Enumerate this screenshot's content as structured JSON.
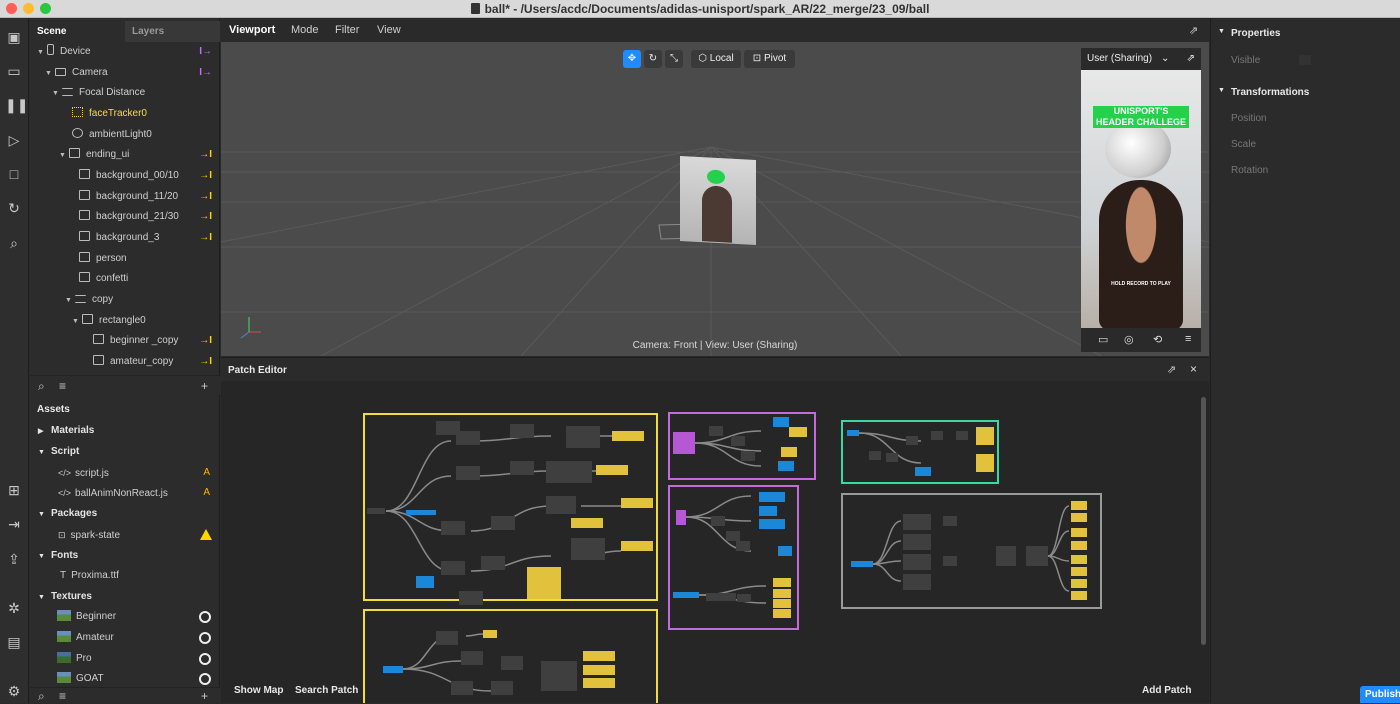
{
  "window": {
    "title": "ball* - /Users/acdc/Documents/adidas-unisport/spark_AR/22_merge/23_09/ball"
  },
  "scene_tabs": {
    "scene": "Scene",
    "layers": "Layers"
  },
  "scene_tree": [
    {
      "label": "Device",
      "badge": "I→",
      "badge_color": "purple"
    },
    {
      "label": "Camera",
      "badge": "I→",
      "badge_color": "purple"
    },
    {
      "label": "Focal Distance",
      "badge": "",
      "badge_color": ""
    },
    {
      "label": "faceTracker0",
      "badge": "",
      "badge_color": ""
    },
    {
      "label": "ambientLight0",
      "badge": "",
      "badge_color": ""
    },
    {
      "label": "ending_ui",
      "badge": "→I",
      "badge_color": "yellow"
    },
    {
      "label": "background_00/10",
      "badge": "→I",
      "badge_color": "yellow"
    },
    {
      "label": "background_11/20",
      "badge": "→I",
      "badge_color": "yellow"
    },
    {
      "label": "background_21/30",
      "badge": "→I",
      "badge_color": "yellow"
    },
    {
      "label": "background_3",
      "badge": "→I",
      "badge_color": "yellow"
    },
    {
      "label": "person",
      "badge": "",
      "badge_color": ""
    },
    {
      "label": "confetti",
      "badge": "",
      "badge_color": ""
    },
    {
      "label": "copy",
      "badge": "",
      "badge_color": ""
    },
    {
      "label": "rectangle0",
      "badge": "",
      "badge_color": ""
    },
    {
      "label": "beginner _copy",
      "badge": "→I",
      "badge_color": "yellow"
    },
    {
      "label": "amateur_copy",
      "badge": "→I",
      "badge_color": "yellow"
    }
  ],
  "assets": {
    "title": "Assets",
    "groups": {
      "materials": "Materials",
      "script": "Script",
      "script_js": "script.js",
      "anim_js": "ballAnimNonReact.js",
      "js_badge": "A",
      "packages": "Packages",
      "spark_state": "spark-state",
      "fonts": "Fonts",
      "proxima": "Proxima.ttf",
      "textures": "Textures",
      "beginner": "Beginner",
      "amateur": "Amateur",
      "pro": "Pro",
      "goat": "GOAT"
    }
  },
  "viewport": {
    "tabs": [
      "Viewport",
      "Mode",
      "Filter",
      "View"
    ],
    "local_label": "Local",
    "pivot_label": "Pivot",
    "camera_info": "Camera: Front | View: User (Sharing)",
    "preview_select": "User (Sharing)",
    "preview_title_1": "UNISPORT'S",
    "preview_title_2": "HEADER CHALLEGE",
    "preview_hold": "HOLD RECORD TO PLAY"
  },
  "patch_editor": {
    "title": "Patch Editor",
    "show_map": "Show Map",
    "search_patch": "Search Patch",
    "add_patch": "Add Patch"
  },
  "properties": {
    "title": "Properties",
    "visible": "Visible",
    "transformations": "Transformations",
    "position": "Position",
    "scale": "Scale",
    "rotation": "Rotation",
    "publish": "Publish"
  },
  "colors": {
    "accent_blue": "#1e8bff",
    "node_yellow": "#e2c23c",
    "node_blue": "#1a87d9",
    "node_purple": "#b657d6",
    "frame_yellow": "#f0dc3a",
    "frame_purple": "#c46adc",
    "frame_green": "#3ad9a0",
    "frame_gray": "#9a9a9a"
  }
}
